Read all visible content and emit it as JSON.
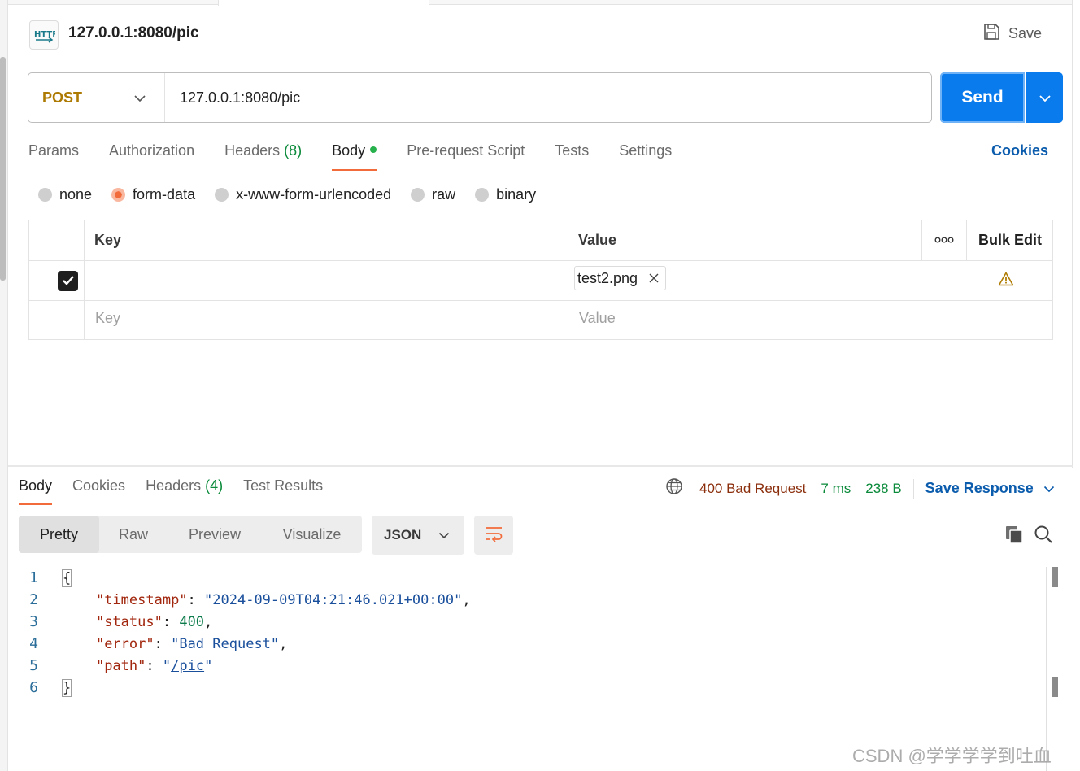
{
  "request": {
    "title": "127.0.0.1:8080/pic",
    "save_label": "Save",
    "method": "POST",
    "url": "127.0.0.1:8080/pic",
    "send_label": "Send"
  },
  "request_tabs": {
    "params": "Params",
    "authorization": "Authorization",
    "headers": "Headers",
    "headers_count": "(8)",
    "body": "Body",
    "pre_request": "Pre-request Script",
    "tests": "Tests",
    "settings": "Settings",
    "cookies": "Cookies"
  },
  "body_types": {
    "none": "none",
    "form_data": "form-data",
    "urlencoded": "x-www-form-urlencoded",
    "raw": "raw",
    "binary": "binary",
    "selected": "form-data"
  },
  "form_table": {
    "key_header": "Key",
    "value_header": "Value",
    "bulk_edit": "Bulk Edit",
    "rows": [
      {
        "checked": true,
        "key": "",
        "value": "test2.png"
      }
    ],
    "key_placeholder": "Key",
    "value_placeholder": "Value"
  },
  "response": {
    "tabs": {
      "body": "Body",
      "cookies": "Cookies",
      "headers": "Headers",
      "headers_count": "(4)",
      "test_results": "Test Results"
    },
    "status": "400 Bad Request",
    "time": "7 ms",
    "size": "238 B",
    "save_response": "Save Response",
    "views": {
      "pretty": "Pretty",
      "raw": "Raw",
      "preview": "Preview",
      "visualize": "Visualize"
    },
    "format": "JSON",
    "code_lines": [
      "1",
      "2",
      "3",
      "4",
      "5",
      "6"
    ],
    "json": {
      "open": "{",
      "timestamp_key": "\"timestamp\"",
      "timestamp_val": "\"2024-09-09T04:21:46.021+00:00\"",
      "status_key": "\"status\"",
      "status_val": "400",
      "error_key": "\"error\"",
      "error_val": "\"Bad Request\"",
      "path_key": "\"path\"",
      "path_val": "/pic",
      "close": "}"
    }
  },
  "watermark": "CSDN @学学学学到吐血",
  "colors": {
    "send_blue": "#097bed",
    "method_gold": "#ad7a03",
    "accent_orange": "#f26b3a",
    "status_red": "#8b2e0c",
    "ok_green": "#0a8a3a",
    "link_blue": "#0b5cad"
  }
}
